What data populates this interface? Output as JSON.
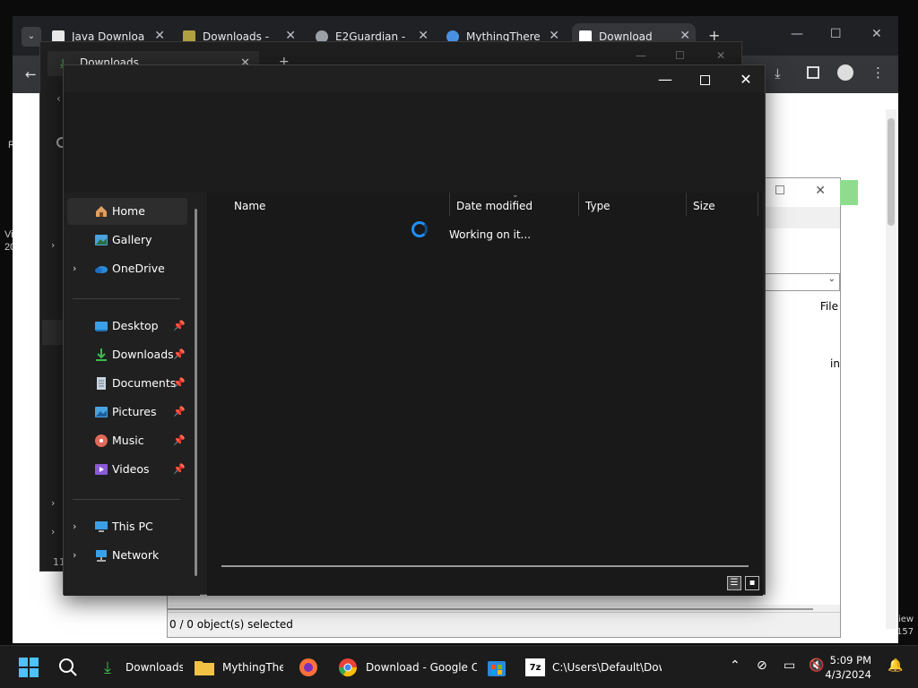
{
  "browser": {
    "tabs": [
      {
        "label": "Java Downloa",
        "close": "✕"
      },
      {
        "label": "Downloads - ",
        "close": "✕"
      },
      {
        "label": "E2Guardian - ",
        "close": "✕"
      },
      {
        "label": "MythingThere",
        "close": "✕"
      },
      {
        "label": "Download",
        "close": "✕"
      }
    ],
    "new_tab": "+"
  },
  "background_page": {
    "left_chars": [
      "R",
      "Vi",
      "20",
      "11"
    ],
    "right_chars": [
      "iew",
      "157"
    ]
  },
  "sevenzip": {
    "status": "0 / 0 object(s) selected",
    "file_label": "File",
    "in_label": "in"
  },
  "downloads_window": {
    "tab_label": "Downloads",
    "close": "✕",
    "new_tab": "+"
  },
  "explorer": {
    "nav": [
      {
        "label": "Home",
        "icon": "home-icon"
      },
      {
        "label": "Gallery",
        "icon": "gallery-icon"
      },
      {
        "label": "OneDrive",
        "icon": "onedrive-icon"
      },
      {
        "label": "Desktop",
        "icon": "desktop-icon"
      },
      {
        "label": "Downloads",
        "icon": "downloads-icon"
      },
      {
        "label": "Documents",
        "icon": "documents-icon"
      },
      {
        "label": "Pictures",
        "icon": "pictures-icon"
      },
      {
        "label": "Music",
        "icon": "music-icon"
      },
      {
        "label": "Videos",
        "icon": "videos-icon"
      },
      {
        "label": "This PC",
        "icon": "this-pc-icon"
      },
      {
        "label": "Network",
        "icon": "network-icon"
      }
    ],
    "columns": {
      "name": "Name",
      "date_modified": "Date modified",
      "type": "Type",
      "size": "Size"
    },
    "status_message": "Working on it..."
  },
  "taskbar": {
    "items": [
      {
        "label": "Downloads"
      },
      {
        "label": "MythingThe"
      },
      {
        "label": "Download - Google C"
      },
      {
        "label": "C:\\Users\\Default\\Dow"
      }
    ],
    "time": "5:09 PM",
    "date": "4/3/2024"
  }
}
